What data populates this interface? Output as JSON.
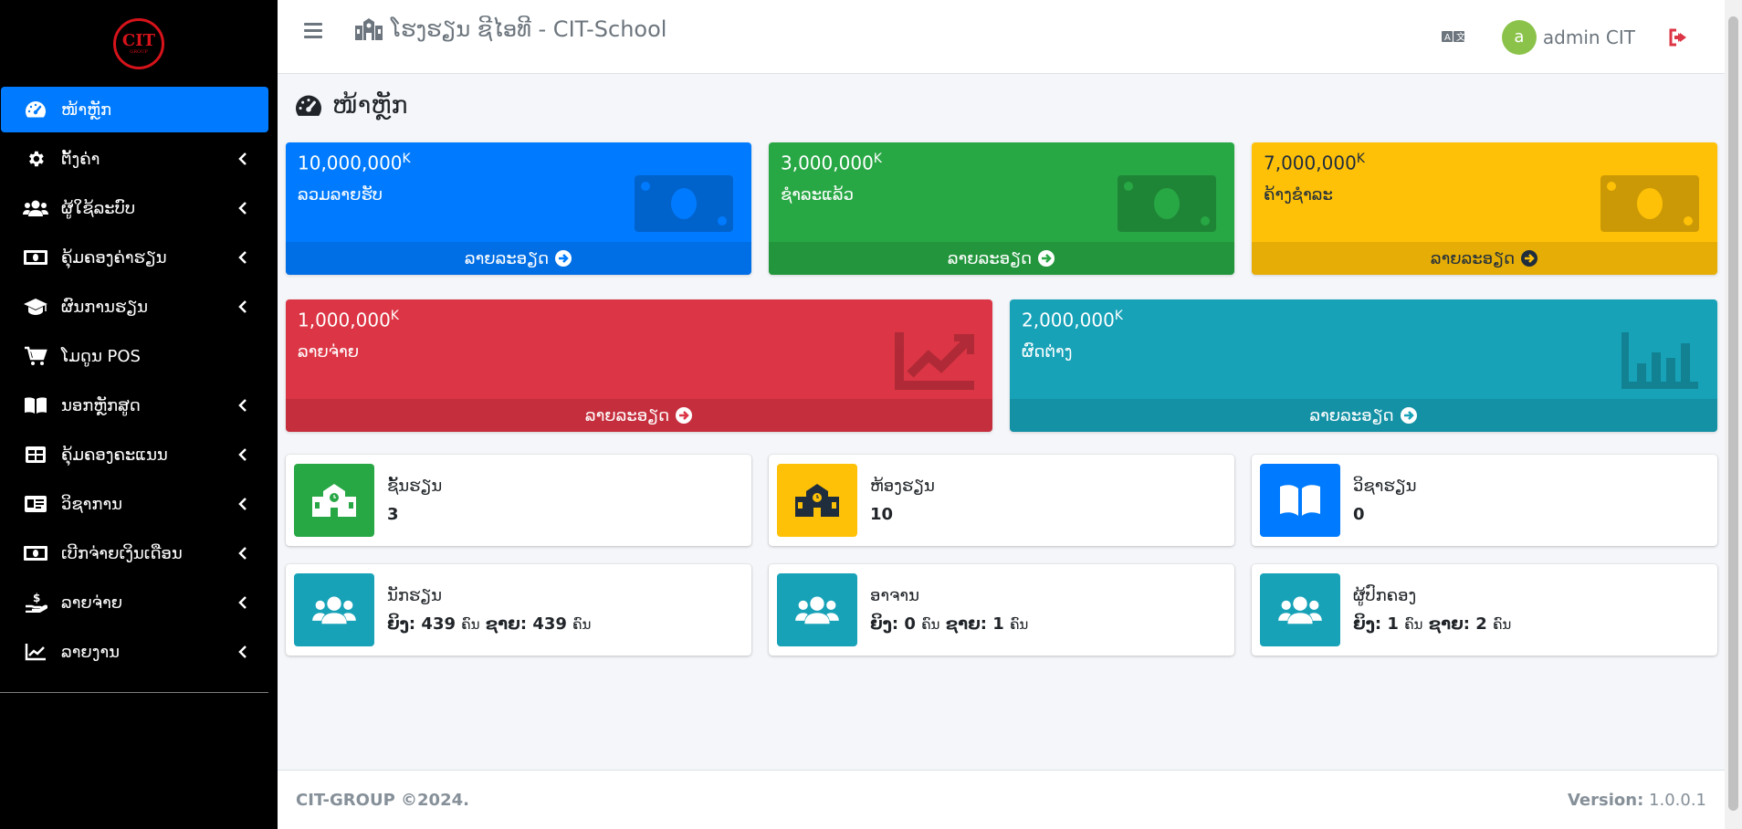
{
  "logo": {
    "big": "CIT",
    "small": "GROUP"
  },
  "header": {
    "brand": "ໂຮງຮຽນ ຊີໄອທີ - CIT-School",
    "avatar_letter": "a",
    "user_name": "admin CIT"
  },
  "sidebar": {
    "items": [
      {
        "label": "ໜ້າຫຼັກ",
        "icon": "dashboard-icon",
        "active": true
      },
      {
        "label": "ຕັ້ງຄ່າ",
        "icon": "gear-icon"
      },
      {
        "label": "ຜູ້ໃຊ້ລະບົບ",
        "icon": "users-icon"
      },
      {
        "label": "ຄຸ້ມຄອງຄ່າຮຽນ",
        "icon": "money-icon"
      },
      {
        "label": "ຜົນການຮຽນ",
        "icon": "graduation-cap-icon"
      },
      {
        "label": "ໂມດູນ POS",
        "icon": "cart-icon"
      },
      {
        "label": "ນອກຫຼັກສູດ",
        "icon": "book-icon"
      },
      {
        "label": "ຄຸ້ມຄອງຄະແນນ",
        "icon": "table-icon"
      },
      {
        "label": "ວິຊາການ",
        "icon": "id-card-icon"
      },
      {
        "label": "ເບີກຈ່າຍເງິນເດືອນ",
        "icon": "money-icon"
      },
      {
        "label": "ລາຍຈ່າຍ",
        "icon": "hand-money-icon"
      },
      {
        "label": "ລາຍງານ",
        "icon": "chart-line-icon"
      }
    ]
  },
  "page": {
    "title": "ໜ້າຫຼັກ"
  },
  "stats": {
    "more_label": "ລາຍລະອຽດ",
    "currency": "K",
    "total_income": {
      "value": "10,000,000",
      "label": "ລວມລາຍຮັບ",
      "color": "#007bff"
    },
    "paid": {
      "value": "3,000,000",
      "label": "ຊຳລະແລ້ວ",
      "color": "#28a745"
    },
    "unpaid": {
      "value": "7,000,000",
      "label": "ຄ້າງຊຳລະ",
      "color": "#ffc107"
    },
    "expense": {
      "value": "1,000,000",
      "label": "ລາຍຈ່າຍ",
      "color": "#dc3545"
    },
    "difference": {
      "value": "2,000,000",
      "label": "ຜົດຕ່າງ",
      "color": "#17a2b8"
    }
  },
  "info": {
    "classes": {
      "label": "ຊັ້ນຮຽນ",
      "value": "3"
    },
    "rooms": {
      "label": "ຫ້ອງຮຽນ",
      "value": "10"
    },
    "subjects": {
      "label": "ວິຊາຮຽນ",
      "value": "0"
    },
    "female_label": "ຍິງ:",
    "male_label": "ຊາຍ:",
    "unit": "ຄົນ",
    "students": {
      "label": "ນັກຮຽນ",
      "female": "439",
      "male": "439"
    },
    "teachers": {
      "label": "ອາຈານ",
      "female": "0",
      "male": "1"
    },
    "parents": {
      "label": "ຜູ້ປົກຄອງ",
      "female": "1",
      "male": "2"
    }
  },
  "footer": {
    "copyright": "CIT-GROUP ©2024.",
    "version_label": "Version:",
    "version": "1.0.0.1"
  }
}
